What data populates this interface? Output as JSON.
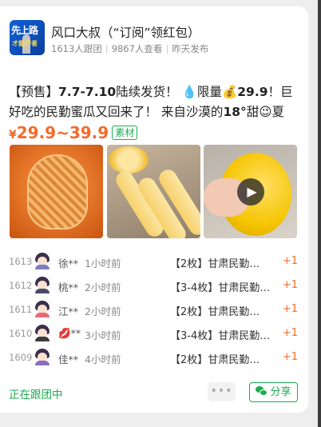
{
  "header": {
    "logo_text_top": "先上路",
    "logo_text_bottom": "才能行者",
    "title": "风口大叔（“订阅”领红包）",
    "followers": "1613人跟团",
    "views": "9867人查看",
    "published": "昨天发布"
  },
  "post": {
    "desc_prefix": "【预售】",
    "desc_dates": "7.7-7.10",
    "desc_part1": "陆续发货！",
    "drop_icon": "💧",
    "desc_limited": "限量",
    "bag_icon": "💰",
    "desc_price": "29.9",
    "desc_part2": "！巨好吃的民勤蜜瓜又回来了！ 来自沙漠的",
    "desc_sweet": "18°",
    "desc_part3": "甜",
    "smile_icon": "😉",
    "desc_part4": "夏天…",
    "price_symbol": "¥",
    "price_range": "29.9~39.9",
    "tag": "素材"
  },
  "images": {
    "play_icon": "▶"
  },
  "orders": [
    {
      "num": "1613",
      "name": "徐**",
      "time": "1小时前",
      "product": "【2枚】甘肃民勤…",
      "qty": "+1",
      "shirt": "#7b7fbf"
    },
    {
      "num": "1612",
      "name": "桃**",
      "time": "2小时前",
      "product": "【3-4枚】甘肃民勤…",
      "qty": "+1",
      "shirt": "#4a4a6a"
    },
    {
      "num": "1611",
      "name": "江**",
      "time": "2小时前",
      "product": "【2枚】甘肃民勤…",
      "qty": "+1",
      "shirt": "#e26a7a"
    },
    {
      "num": "1610",
      "name": "💋**",
      "time": "3小时前",
      "product": "【3-4枚】甘肃民勤…",
      "qty": "+1",
      "shirt": "#3a3a3a"
    },
    {
      "num": "1609",
      "name": "佳**",
      "time": "4小时前",
      "product": "【2枚】甘肃民勤…",
      "qty": "+1",
      "shirt": "#8a6fc0"
    }
  ],
  "footer": {
    "joining": "正在跟团中",
    "more": "•••",
    "share": "分享"
  }
}
